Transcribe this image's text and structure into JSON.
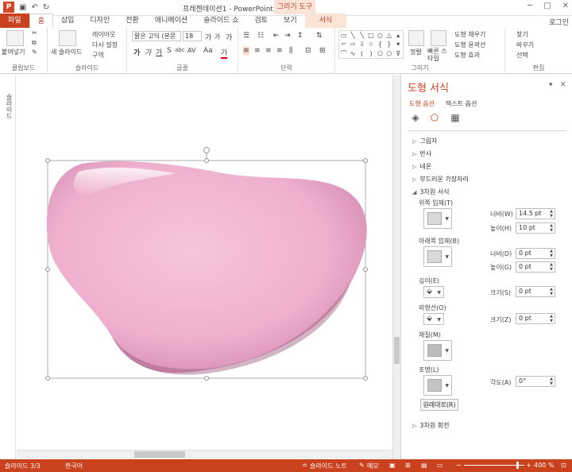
{
  "titlebar": {
    "title": "프레젠테이션1 - PowerPoint",
    "context_title": "그리기 도구",
    "qat_app": "P",
    "qat_save": "▣",
    "qat_undo": "↶",
    "qat_redo": "↻",
    "min": "─",
    "max": "□",
    "close": "✕"
  },
  "tabs": [
    {
      "label": "파일"
    },
    {
      "label": "홈"
    },
    {
      "label": "삽입"
    },
    {
      "label": "디자인"
    },
    {
      "label": "전환"
    },
    {
      "label": "애니메이션"
    },
    {
      "label": "슬라이드 쇼"
    },
    {
      "label": "검토"
    },
    {
      "label": "보기"
    },
    {
      "label": "서식"
    }
  ],
  "login": "로그인",
  "ribbon": {
    "clipboard": {
      "label": "클립보드",
      "paste": "붙여넣기"
    },
    "slides": {
      "label": "슬라이드",
      "new_slide": "새 슬라이드",
      "layout": "레이아웃",
      "reset": "다시 설정",
      "section": "구역"
    },
    "font": {
      "label": "글꼴",
      "font_name": "맑은 고딕 (본문",
      "font_size": "18",
      "grow": "가",
      "shrink": "가",
      "bold": "가",
      "italic": "가",
      "underline": "가",
      "strike": "S",
      "abc": "abc",
      "spacing": "AV",
      "case": "Aa",
      "clear": "가",
      "color": "가"
    },
    "paragraph": {
      "label": "단락"
    },
    "drawing": {
      "label": "그리기",
      "arrange": "정렬",
      "quick_styles": "빠른 스타일",
      "fill": "도형 채우기",
      "outline": "도형 윤곽선",
      "effects": "도형 효과"
    },
    "editing": {
      "label": "편집",
      "find": "찾기",
      "replace": "바꾸기",
      "select": "선택"
    }
  },
  "left_strip": {
    "label": "슬라이드"
  },
  "pane": {
    "title": "도형 서식",
    "tab_shape": "도형 옵션",
    "tab_text": "텍스트 옵션",
    "sections": {
      "shadow": "그림자",
      "reflection": "반사",
      "glow": "네온",
      "soft_edges": "부드러운 가장자리",
      "three_d_format": "3차원 서식",
      "three_d_rotation": "3차원 회전"
    },
    "top_bevel": "위쪽 입체(T)",
    "bottom_bevel": "아래쪽 입체(B)",
    "depth": "깊이(E)",
    "contour": "외형선(O)",
    "material": "재질(M)",
    "lighting": "조명(L)",
    "width_label": "너비(W)",
    "height_label": "높이(H)",
    "width_b_label": "너비(D)",
    "height_b_label": "높이(G)",
    "size_label": "크기(S)",
    "size_label2": "크기(Z)",
    "angle_label": "각도(A)",
    "top_width": "14.5 pt",
    "top_height": "10 pt",
    "bottom_width": "0 pt",
    "bottom_height": "0 pt",
    "depth_size": "0 pt",
    "contour_size": "0 pt",
    "light_angle": "0°",
    "reset": "원래대로(R)"
  },
  "status": {
    "slide": "슬라이드 3/3",
    "language": "한국어",
    "notes": "슬라이드 노트",
    "comments": "메모",
    "zoom": "400 %"
  },
  "colors": {
    "accent": "#c9411d",
    "shape_fill": "#f2b6d4"
  }
}
